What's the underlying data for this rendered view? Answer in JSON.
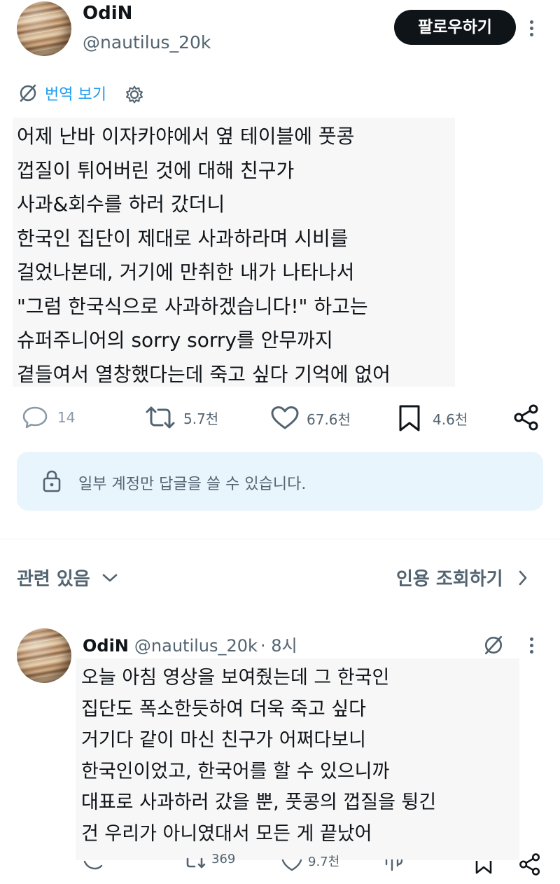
{
  "tweet": {
    "author_name": "OdiN",
    "author_handle": "@nautilus_20k",
    "follow_label": "팔로우하기",
    "translate_label": "번역 보기",
    "lines": [
      "어제 난바 이자카야에서 옆 테이블에 풋콩",
      "껍질이 튀어버린 것에 대해 친구가",
      "사과&회수를 하러 갔더니",
      "한국인 집단이 제대로 사과하라며 시비를",
      "걸었나본데, 거기에 만취한 내가 나타나서",
      "\"그럼 한국식으로 사과하겠습니다!\" 하고는",
      "슈퍼주니어의 sorry sorry를 안무까지",
      "곁들여서 열창했다는데 죽고 싶다 기억에 없어"
    ],
    "metrics": {
      "replies": "14",
      "retweets": "5.7천",
      "likes": "67.6천",
      "bookmarks": "4.6천"
    },
    "reply_restriction": "일부 계정만 답글을 쓸 수 있습니다."
  },
  "related": {
    "title": "관련 있음",
    "quote_link": "인용 조회하기"
  },
  "reply": {
    "author_name": "OdiN",
    "author_handle": "@nautilus_20k",
    "time": "· 8시",
    "lines": [
      "오늘 아침 영상을 보여줬는데 그 한국인",
      "집단도 폭소한듯하여 더욱 죽고 싶다",
      "거기다 같이 마신 친구가 어쩌다보니",
      "한국인이었고, 한국어를 할 수 있으니까",
      "대표로 사과하러 갔을 뿐, 풋콩의 껍질을 튕긴",
      "건 우리가 아니였대서 모든 게 끝났어"
    ],
    "metrics": {
      "retweets": "369",
      "likes": "9.7천"
    }
  },
  "icons": [
    "translate-icon",
    "gear-icon",
    "more-icon",
    "reply-icon",
    "retweet-icon",
    "like-icon",
    "bookmark-icon",
    "share-icon",
    "lock-icon",
    "chevron-down-icon",
    "chevron-right-icon",
    "views-icon"
  ],
  "colors": {
    "accent": "#1d9bf0",
    "text_primary": "#0f1419",
    "text_secondary": "#536471",
    "reply_box_bg": "#e8f5fd",
    "button_bg": "#0f1419"
  }
}
